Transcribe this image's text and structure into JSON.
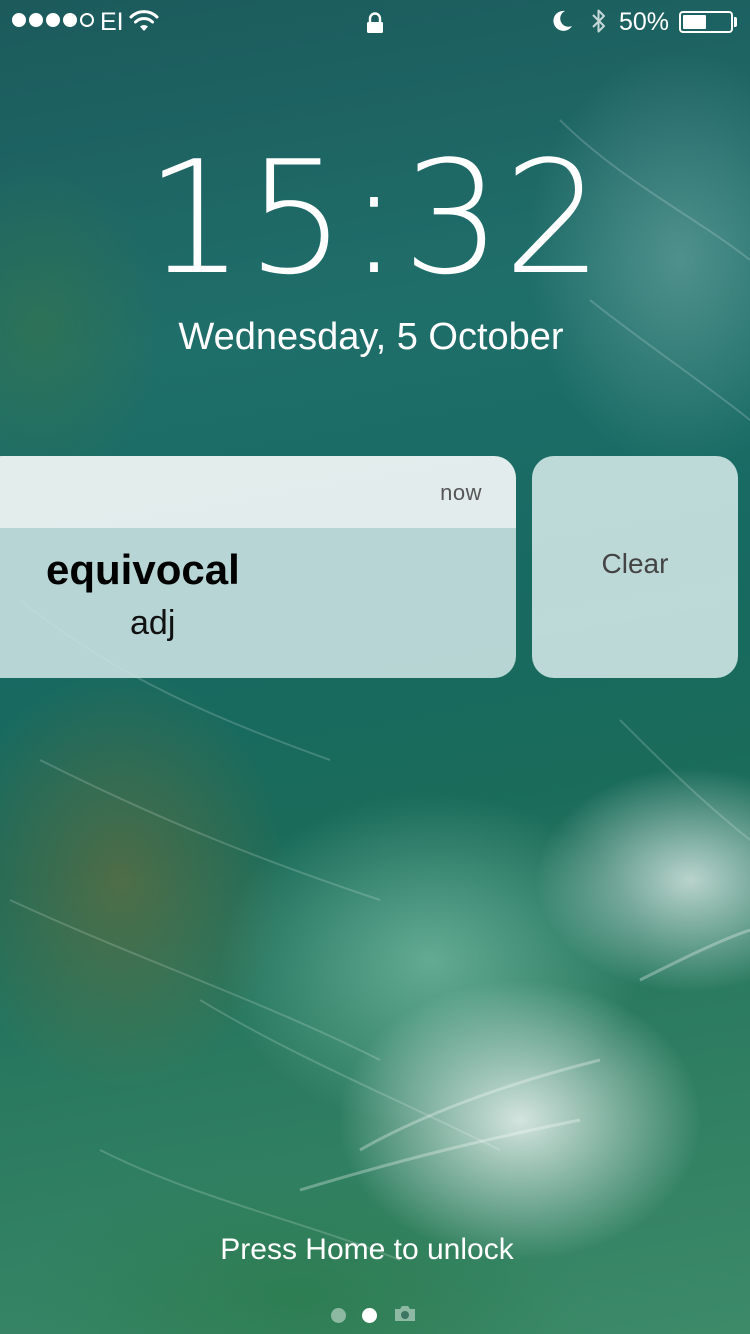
{
  "status_bar": {
    "signal_bars_filled": 4,
    "signal_bars_total": 5,
    "carrier": "EI",
    "battery_percent": "50%",
    "battery_level": 0.5
  },
  "lock_screen": {
    "time": "15:32",
    "date": "Wednesday, 5 October"
  },
  "notification": {
    "time": "now",
    "title": "equivocal",
    "body": "adj",
    "clear_label": "Clear"
  },
  "footer": {
    "unlock_hint": "Press Home to unlock",
    "page_count": 2,
    "active_page": 1
  },
  "icons": {
    "wifi": "wifi-icon",
    "lock": "lock-icon",
    "do_not_disturb": "moon-icon",
    "bluetooth": "bluetooth-icon",
    "camera": "camera-icon"
  }
}
